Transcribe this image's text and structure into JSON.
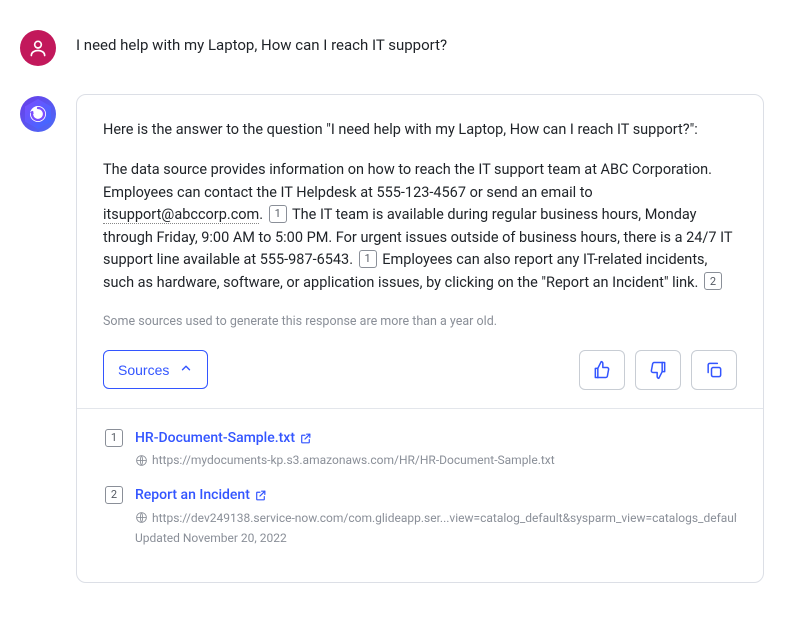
{
  "user": {
    "question": "I need help with my Laptop, How can I reach IT support?"
  },
  "bot": {
    "intro": "Here is the answer to the question \"I need help with my Laptop, How can I reach IT support?\":",
    "body_part1": "The data source provides information on how to reach the IT support team at ABC Corporation. Employees can contact the IT Helpdesk at 555-123-4567 or send an email to",
    "email": "itsupport@abccorp.com",
    "body_part2": "The IT team is available during regular business hours, Monday through Friday, 9:00 AM to 5:00 PM. For urgent issues outside of business hours, there is a 24/7 IT support line available at 555-987-6543.",
    "body_part3": "Employees can also report any IT-related incidents, such as hardware, software, or application issues, by clicking on the \"Report an Incident\" link.",
    "citations": {
      "c1": "1",
      "c1b": "1",
      "c2": "2"
    },
    "disclaimer": "Some sources used to generate this response are more than a year old.",
    "sources_label": "Sources"
  },
  "sources": [
    {
      "num": "1",
      "title": "HR-Document-Sample.txt",
      "url": "https://mydocuments-kp.s3.amazonaws.com/HR/HR-Document-Sample.txt"
    },
    {
      "num": "2",
      "title": "Report an Incident",
      "url": "https://dev249138.service-now.com/com.glideapp.ser...view=catalog_default&sysparm_view=catalogs_default",
      "updated": "Updated November 20, 2022"
    }
  ]
}
